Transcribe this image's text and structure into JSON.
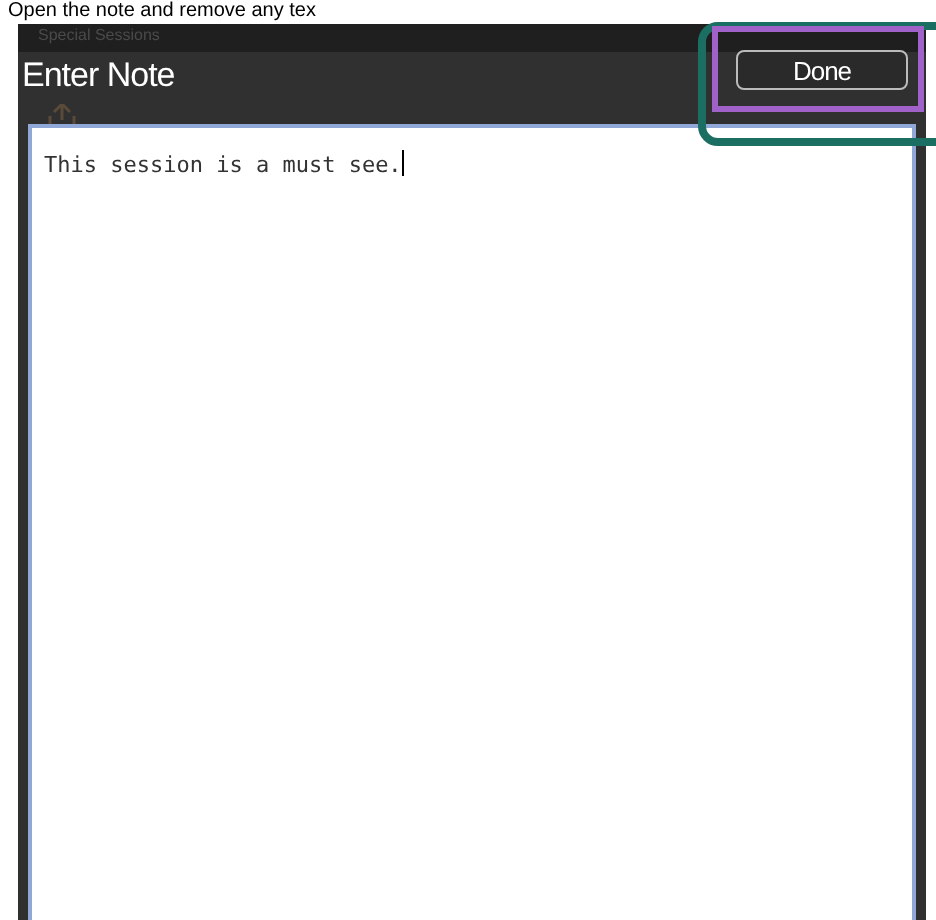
{
  "caption": "Open the note and remove any tex",
  "background_title": "Special Sessions",
  "dialog": {
    "title": "Enter Note",
    "done_button": "Done",
    "note": {
      "value": "This session is a must see.",
      "focused": true
    }
  }
}
